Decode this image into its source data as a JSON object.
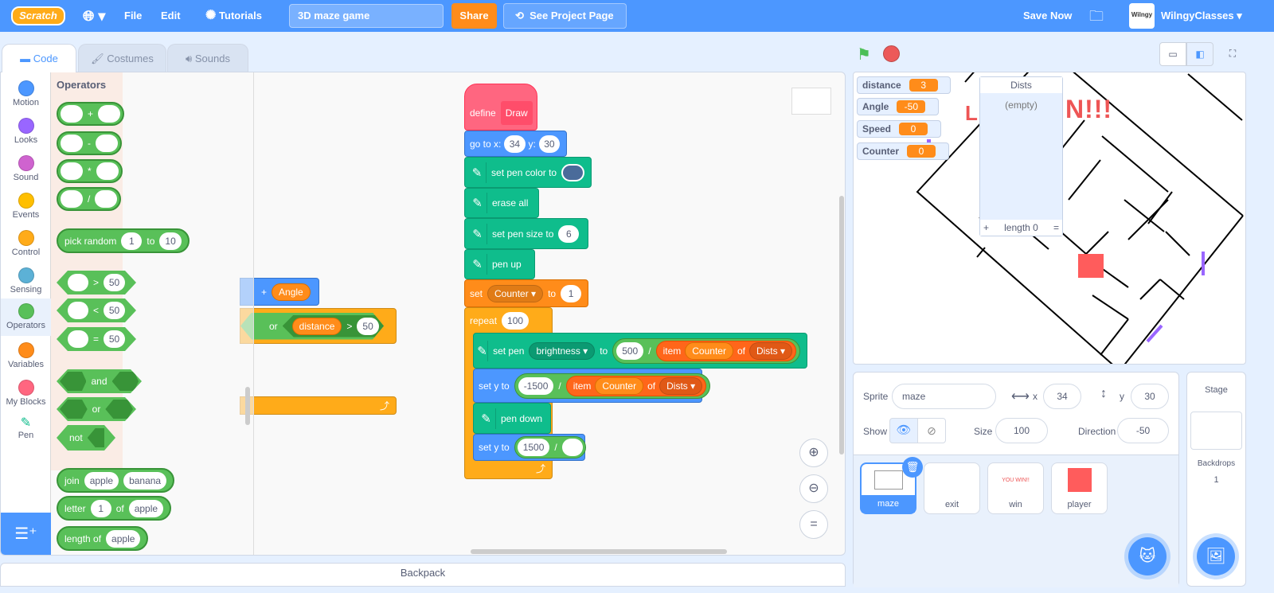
{
  "menu": {
    "logo": "Scratch",
    "file": "File",
    "edit": "Edit",
    "tutorials": "Tutorials",
    "project_title": "3D maze game",
    "share": "Share",
    "see_project_page": "See Project Page",
    "save_now": "Save Now",
    "avatar_text": "Wilngy",
    "username": "WilngyClasses"
  },
  "tabs": {
    "code": "Code",
    "costumes": "Costumes",
    "sounds": "Sounds"
  },
  "categories": [
    {
      "label": "Motion",
      "color": "#4c97ff"
    },
    {
      "label": "Looks",
      "color": "#9966ff"
    },
    {
      "label": "Sound",
      "color": "#cf63cf"
    },
    {
      "label": "Events",
      "color": "#ffbf00"
    },
    {
      "label": "Control",
      "color": "#ffab19"
    },
    {
      "label": "Sensing",
      "color": "#5cb1d6"
    },
    {
      "label": "Operators",
      "color": "#59c059"
    },
    {
      "label": "Variables",
      "color": "#ff8c1a"
    },
    {
      "label": "My Blocks",
      "color": "#ff6680"
    },
    {
      "label": "Pen",
      "color": "#0fbd8c"
    }
  ],
  "palette": {
    "heading": "Operators",
    "add": "+",
    "sub": "-",
    "mul": "*",
    "div": "/",
    "pick_random": "pick random",
    "pr_from": "1",
    "pr_to_label": "to",
    "pr_to": "10",
    "gt": ">",
    "lt": "<",
    "eq": "=",
    "cmp_value": "50",
    "and": "and",
    "or": "or",
    "not": "not",
    "join": "join",
    "join_a": "apple",
    "join_b": "banana",
    "letter": "letter",
    "letter_n": "1",
    "letter_of": "of",
    "letter_s": "apple",
    "length_of": "length of",
    "length_s": "apple"
  },
  "script": {
    "define": "define",
    "draw": "Draw",
    "goto": "go to x:",
    "goto_x": "34",
    "goto_y_label": "y:",
    "goto_y": "30",
    "set_pen_color": "set pen color to",
    "pen_color": "#4a6b9a",
    "erase_all": "erase all",
    "set_pen_size": "set pen size to",
    "pen_size": "6",
    "pen_up": "pen up",
    "set": "set",
    "counter_var": "Counter",
    "to": "to",
    "set_value": "1",
    "repeat": "repeat",
    "repeat_n": "100",
    "set_pen": "set pen",
    "brightness": "brightness",
    "brightness_value": "500",
    "divide": "/",
    "item": "item",
    "of": "of",
    "list": "Dists",
    "set_y_to": "set y to",
    "y_a": "-1500",
    "pen_down": "pen down",
    "y_b": "1500",
    "stray_plus": "+",
    "stray_angle": "Angle",
    "stray_or": "or",
    "stray_distance": "distance",
    "stray_gt": ">",
    "stray_value": "50"
  },
  "stage": {
    "monitors": [
      {
        "name": "distance",
        "value": "3"
      },
      {
        "name": "Angle",
        "value": "-50"
      },
      {
        "name": "Speed",
        "value": "0"
      },
      {
        "name": "Counter",
        "value": "0"
      }
    ],
    "list": {
      "name": "Dists",
      "empty": "(empty)",
      "add": "+",
      "length": "length 0",
      "resize": "="
    },
    "win_text": "N!!!"
  },
  "sprite_info": {
    "sprite_label": "Sprite",
    "name": "maze",
    "x_label": "x",
    "x": "34",
    "y_label": "y",
    "y": "30",
    "show_label": "Show",
    "size_label": "Size",
    "size": "100",
    "direction_label": "Direction",
    "direction": "-50"
  },
  "sprites": [
    {
      "name": "maze",
      "selected": true
    },
    {
      "name": "exit"
    },
    {
      "name": "win",
      "thumb_text": "YOU WIN!!"
    },
    {
      "name": "player"
    }
  ],
  "stage_pane": {
    "title": "Stage",
    "backdrops_label": "Backdrops",
    "backdrops": "1"
  },
  "backpack": "Backpack"
}
